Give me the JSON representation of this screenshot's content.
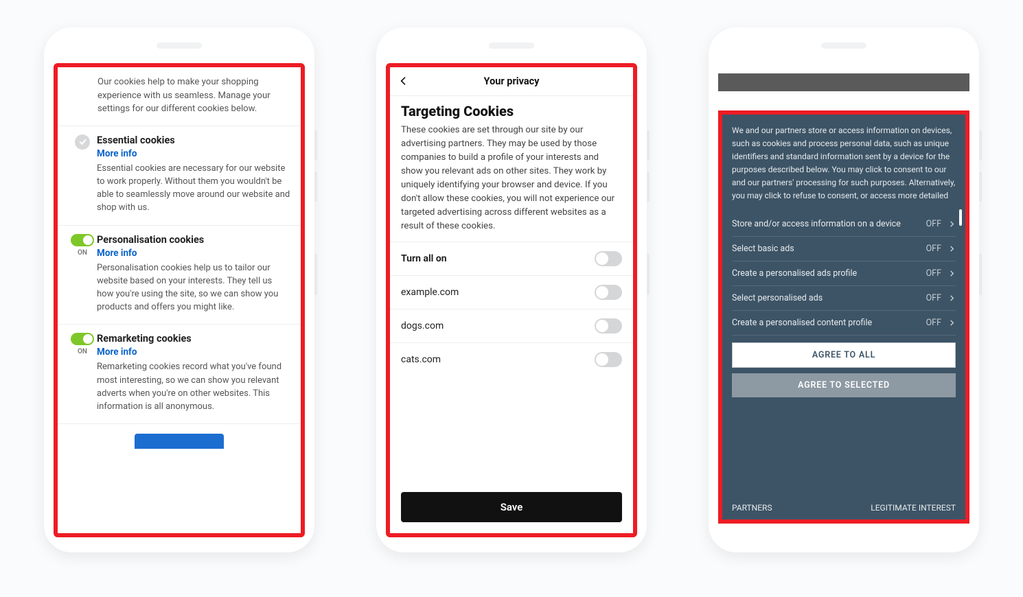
{
  "phone1": {
    "intro": "Our cookies help to make your shopping experience with us seamless. Manage your settings for our different cookies below.",
    "sections": [
      {
        "title": "Essential cookies",
        "more": "More info",
        "desc": "Essential cookies are necessary for our website to work properly. Without them you wouldn't be able to seamlessly move around our website and shop with us."
      },
      {
        "title": "Personalisation cookies",
        "more": "More info",
        "on": "ON",
        "desc": "Personalisation cookies help us to tailor our website based on your interests. They tell us how you're using the site, so we can show you products and offers you might like."
      },
      {
        "title": "Remarketing cookies",
        "more": "More info",
        "on": "ON",
        "desc": "Remarketing cookies record what you've found most interesting, so we can show you relevant adverts when you're on other websites. This information is all anonymous."
      }
    ]
  },
  "phone2": {
    "header": "Your privacy",
    "title": "Targeting Cookies",
    "desc": "These cookies are set through our site by our advertising partners. They may be used by those companies to build a profile of your interests and show you relevant ads on other sites. They work by uniquely identifying your browser and device. If you don't allow these cookies, you will not experience our targeted advertising across different websites as a result of these cookies.",
    "rows": [
      {
        "label": "Turn all on"
      },
      {
        "label": "example.com"
      },
      {
        "label": "dogs.com"
      },
      {
        "label": "cats.com"
      }
    ],
    "save": "Save"
  },
  "phone3": {
    "intro": "We and our partners store or access information on devices, such as cookies and process personal data, such as unique identifiers and standard information sent by a device for the purposes described below. You may click to consent to our and our partners' processing for such purposes. Alternatively, you may click to refuse to consent, or access more detailed",
    "items": [
      {
        "label": "Store and/or access information on a device",
        "state": "OFF"
      },
      {
        "label": "Select basic ads",
        "state": "OFF"
      },
      {
        "label": "Create a personalised ads profile",
        "state": "OFF"
      },
      {
        "label": "Select personalised ads",
        "state": "OFF"
      },
      {
        "label": "Create a personalised content profile",
        "state": "OFF"
      }
    ],
    "agree_all": "AGREE TO ALL",
    "agree_selected": "AGREE TO SELECTED",
    "partners": "PARTNERS",
    "legit": "LEGITIMATE INTEREST"
  }
}
